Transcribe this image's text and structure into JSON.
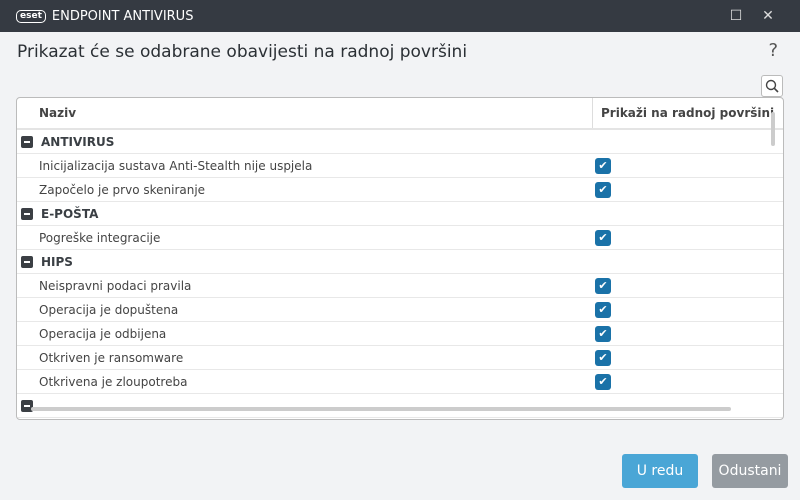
{
  "window": {
    "logo": "eset",
    "title": "ENDPOINT ANTIVIRUS"
  },
  "dialog": {
    "title": "Prikazat će se odabrane obavijesti na radnoj površini",
    "help": "?"
  },
  "table": {
    "col_name": "Naziv",
    "col_show": "Prikaži na radnoj površini",
    "groups": [
      {
        "label": "ANTIVIRUS",
        "items": [
          {
            "label": "Inicijalizacija sustava Anti-Stealth nije uspjela",
            "checked": true
          },
          {
            "label": "Započelo je prvo skeniranje",
            "checked": true
          }
        ]
      },
      {
        "label": "E-POŠTA",
        "items": [
          {
            "label": "Pogreške integracije",
            "checked": true
          }
        ]
      },
      {
        "label": "HIPS",
        "items": [
          {
            "label": "Neispravni podaci pravila",
            "checked": true
          },
          {
            "label": "Operacija je dopuštena",
            "checked": true
          },
          {
            "label": "Operacija je odbijena",
            "checked": true
          },
          {
            "label": "Otkriven je ransomware",
            "checked": true
          },
          {
            "label": "Otkrivena je zloupotreba",
            "checked": true
          }
        ]
      }
    ]
  },
  "buttons": {
    "ok": "U redu",
    "cancel": "Odustani"
  },
  "colors": {
    "ok": "#4aa6d6",
    "cancel": "#959ba1",
    "checkbox": "#1a72a8"
  }
}
